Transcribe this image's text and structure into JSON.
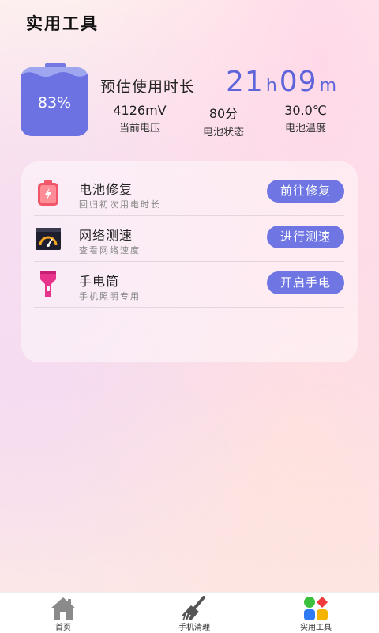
{
  "header": {
    "title": "实用工具"
  },
  "battery": {
    "percent_text": "83%",
    "level": 0.83,
    "estimate_label": "预估使用时长",
    "hours": "21",
    "hours_unit": "h",
    "minutes": "09",
    "minutes_unit": "m",
    "colors": {
      "accent": "#6d72e3",
      "light": "#9fa6f0"
    }
  },
  "stats": [
    {
      "value": "4126mV",
      "label": "当前电压"
    },
    {
      "value": "80分",
      "label": "电池状态"
    },
    {
      "value": "30.0℃",
      "label": "电池温度"
    }
  ],
  "tools": [
    {
      "name": "电池修复",
      "desc": "回归初次用电时长",
      "action": "前往修复",
      "icon": "battery-repair-icon"
    },
    {
      "name": "网络测速",
      "desc": "查看网络速度",
      "action": "进行测速",
      "icon": "speedometer-icon"
    },
    {
      "name": "手电筒",
      "desc": "手机照明专用",
      "action": "开启手电",
      "icon": "flashlight-icon"
    }
  ],
  "nav": [
    {
      "label": "首页",
      "icon": "home-icon"
    },
    {
      "label": "手机清理",
      "icon": "broom-icon"
    },
    {
      "label": "实用工具",
      "icon": "apps-grid-icon"
    }
  ]
}
